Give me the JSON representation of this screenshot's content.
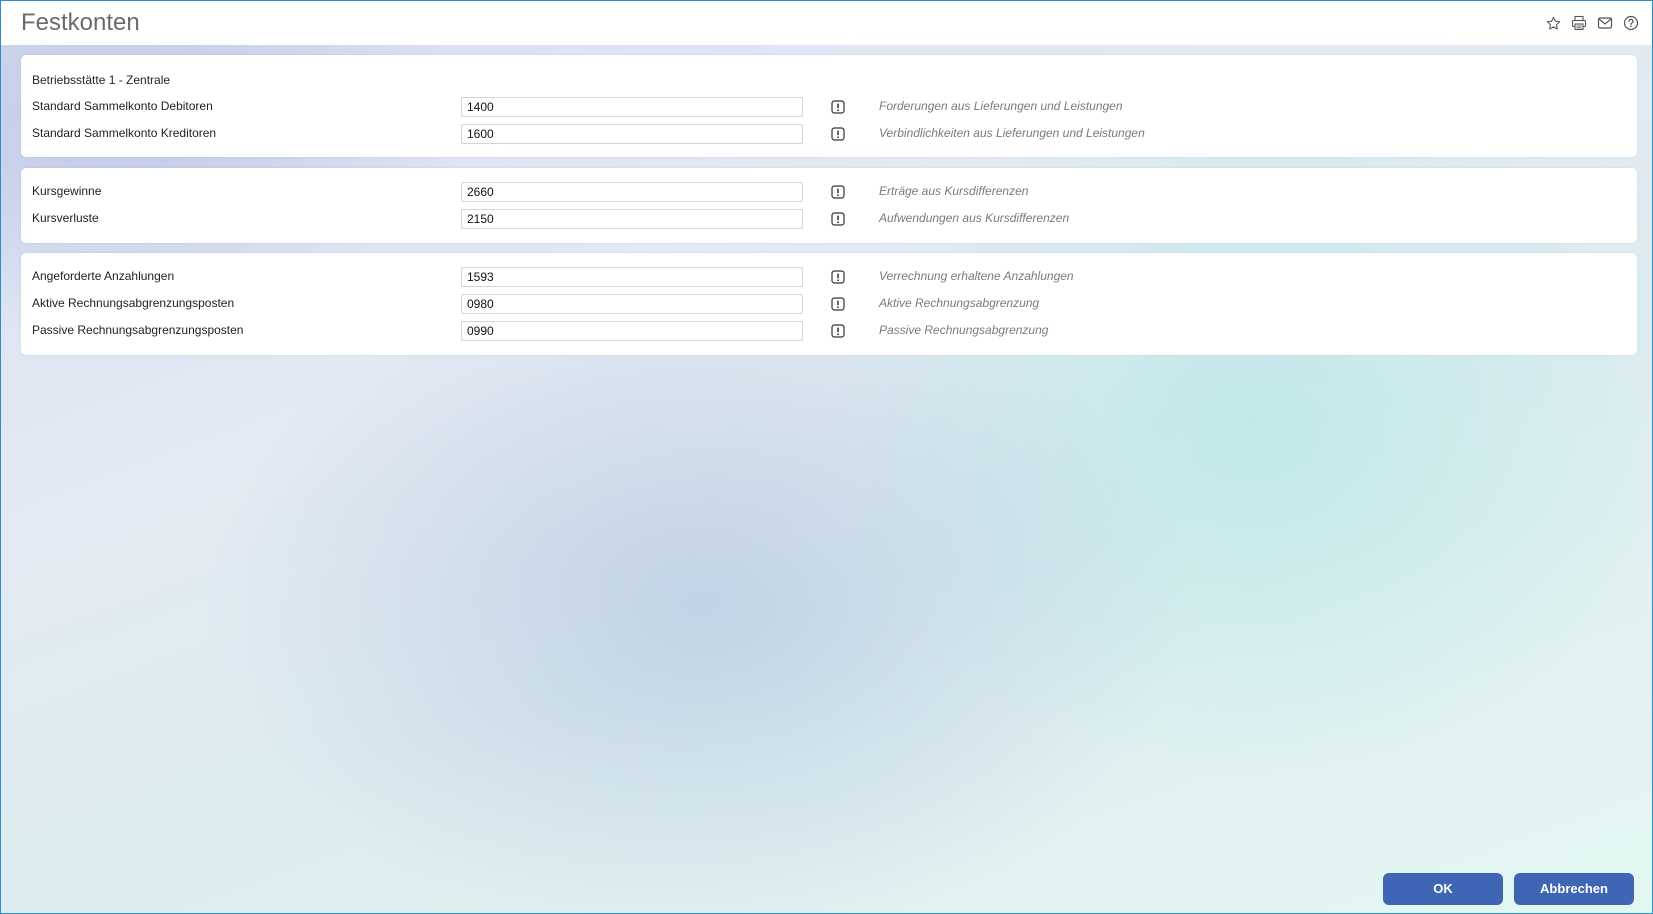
{
  "window": {
    "title": "Festkonten"
  },
  "toolbar": {
    "icons": [
      "star-icon",
      "print-icon",
      "mail-icon",
      "help-icon"
    ]
  },
  "sections": [
    {
      "heading": "Betriebsstätte 1 - Zentrale",
      "rows": [
        {
          "label": "Standard Sammelkonto Debitoren",
          "value": "1400",
          "description": "Forderungen aus Lieferungen und Leistungen"
        },
        {
          "label": "Standard Sammelkonto Kreditoren",
          "value": "1600",
          "description": "Verbindlichkeiten aus Lieferungen und Leistungen"
        }
      ]
    },
    {
      "heading": "",
      "rows": [
        {
          "label": "Kursgewinne",
          "value": "2660",
          "description": "Erträge aus Kursdifferenzen"
        },
        {
          "label": "Kursverluste",
          "value": "2150",
          "description": "Aufwendungen aus Kursdifferenzen"
        }
      ]
    },
    {
      "heading": "",
      "rows": [
        {
          "label": "Angeforderte Anzahlungen",
          "value": "1593",
          "description": "Verrechnung erhaltene Anzahlungen"
        },
        {
          "label": "Aktive Rechnungsabgrenzungsposten",
          "value": "0980",
          "description": "Aktive Rechnungsabgrenzung"
        },
        {
          "label": "Passive Rechnungsabgrenzungsposten",
          "value": "0990",
          "description": "Passive Rechnungsabgrenzung"
        }
      ]
    }
  ],
  "footer": {
    "ok_label": "OK",
    "cancel_label": "Abbrechen"
  },
  "colors": {
    "accent": "#3f66b5",
    "border": "#2a8fc6",
    "title_text": "#6b6b6b",
    "description_text": "#7a7a7a"
  }
}
